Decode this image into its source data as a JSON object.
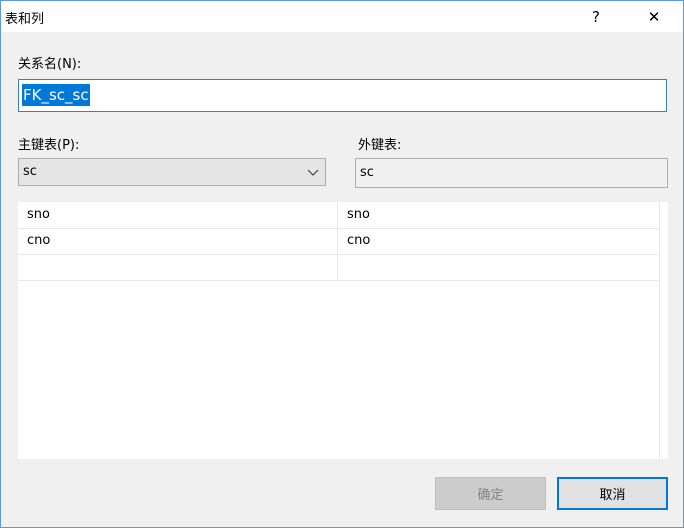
{
  "window": {
    "title": "表和列",
    "help_glyph": "?",
    "close_glyph": "✕"
  },
  "relation_name": {
    "label": "关系名(N):",
    "value": "FK_sc_sc"
  },
  "primary_table": {
    "label": "主键表(P):",
    "selected": "sc"
  },
  "foreign_table": {
    "label": "外键表:",
    "value": "sc"
  },
  "column_mapping": {
    "rows": [
      [
        "sno",
        "sno"
      ],
      [
        "cno",
        "cno"
      ],
      [
        "",
        ""
      ]
    ]
  },
  "buttons": {
    "ok_label": "确定",
    "cancel_label": "取消"
  },
  "icons": {
    "help": "question-mark-icon",
    "close": "close-icon",
    "dropdown": "chevron-down-icon"
  },
  "colors": {
    "accent": "#0078d7",
    "window_border": "#5a9bd5",
    "dialog_bg": "#f0f0f0"
  }
}
